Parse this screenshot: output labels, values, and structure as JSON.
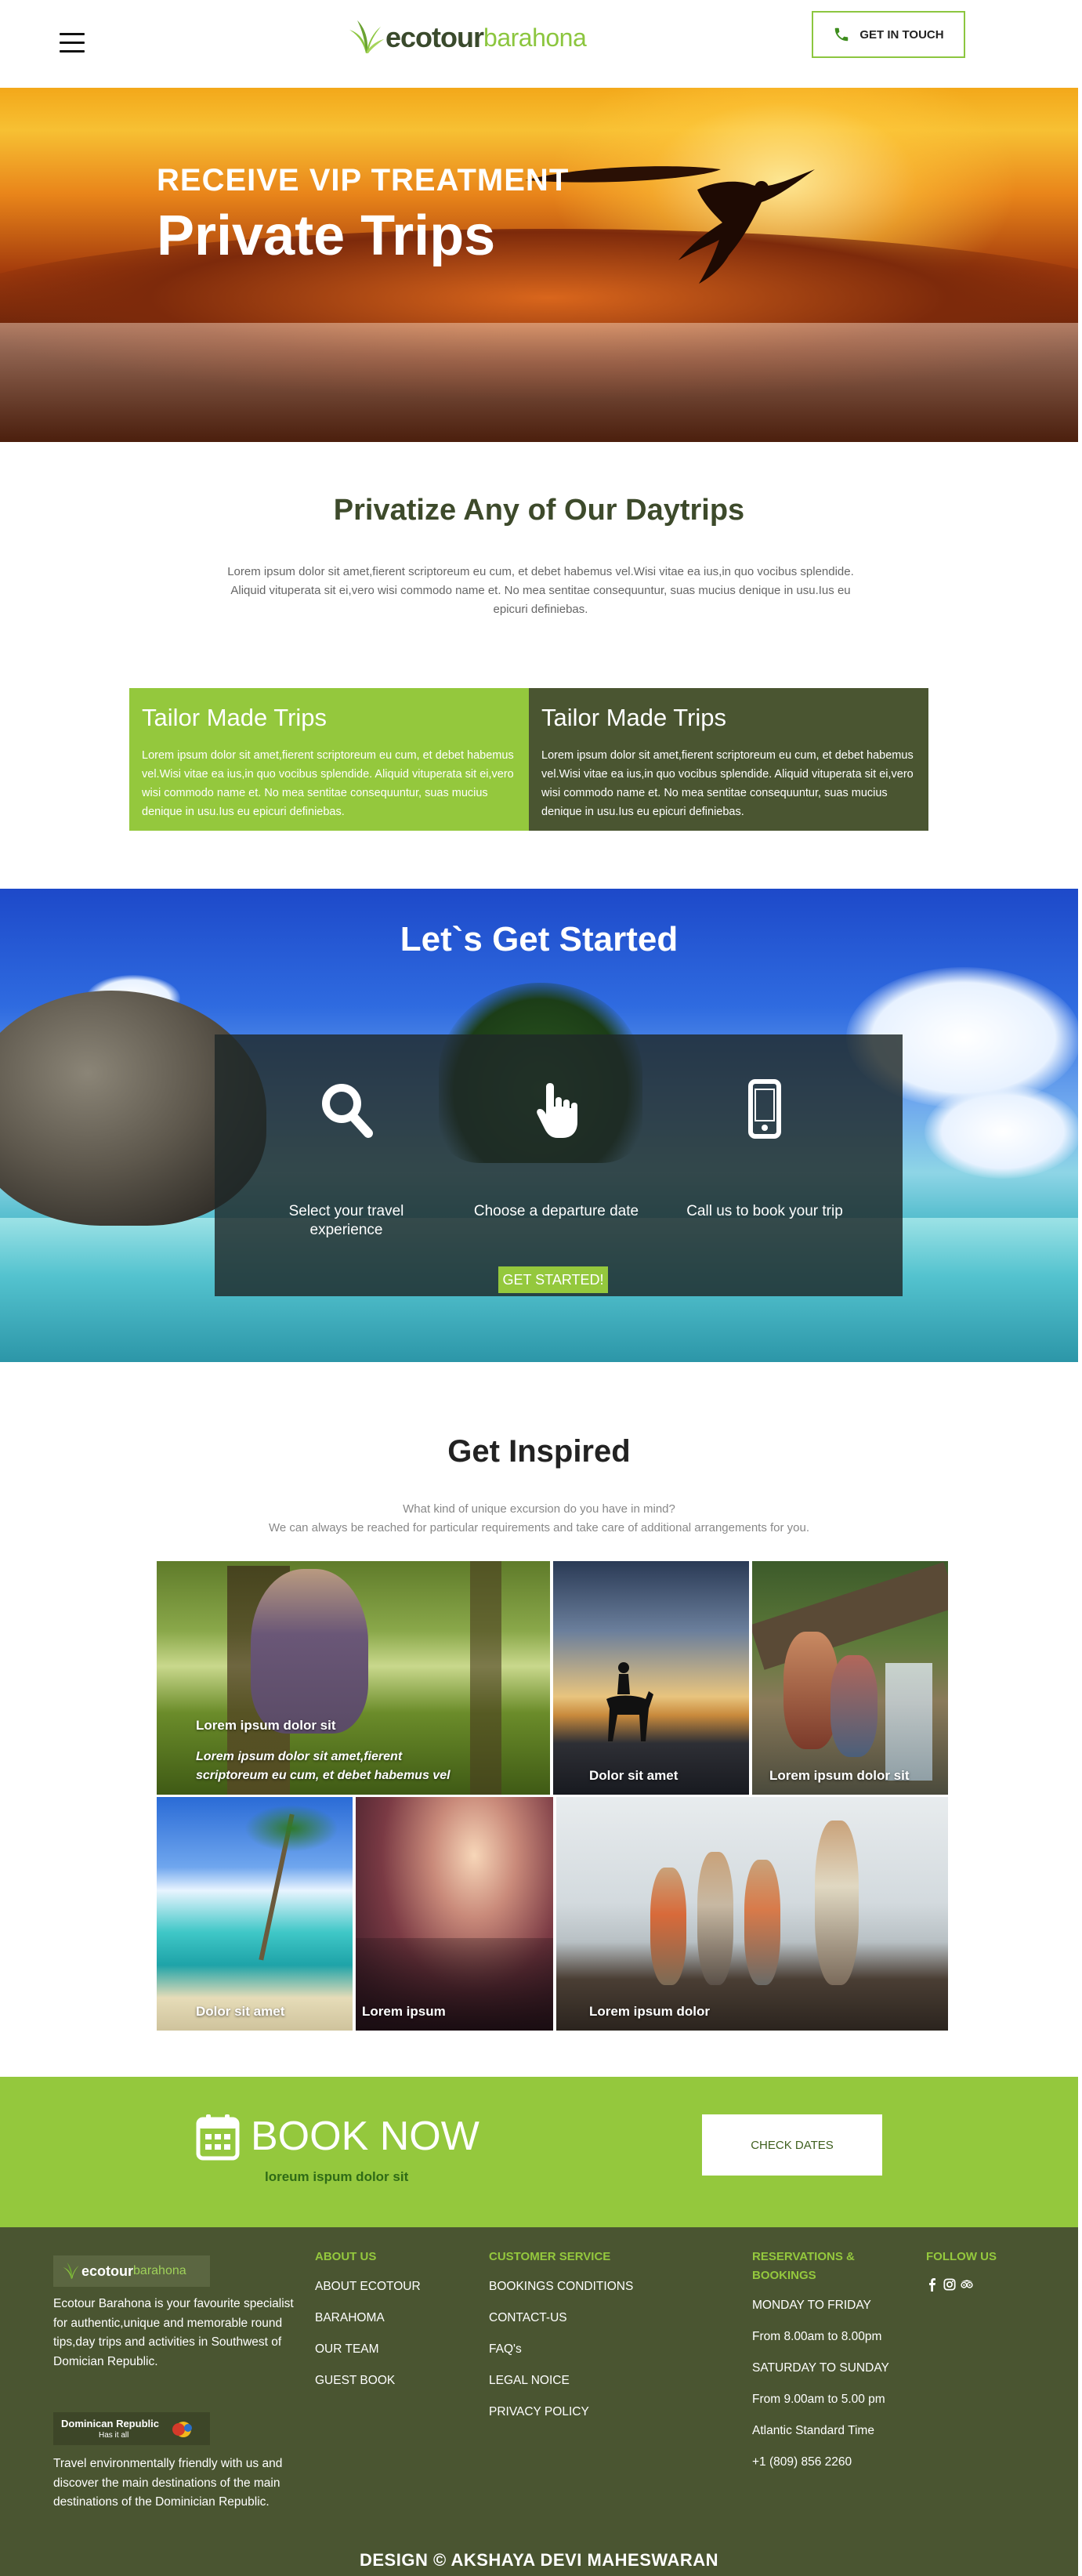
{
  "header": {
    "logo_eco": "ecotour",
    "logo_place": "barahona",
    "touch_label": "GET IN TOUCH"
  },
  "hero": {
    "kicker": "RECEIVE VIP TREATMENT",
    "title": "Private Trips"
  },
  "privatize": {
    "title": "Privatize Any of Our Daytrips",
    "text": "Lorem ipsum dolor sit amet,fierent scriptoreum eu cum, et debet habemus vel.Wisi vitae ea ius,in quo vocibus splendide. Aliquid vituperata sit ei,vero wisi commodo name et. No mea sentitae consequuntur, suas mucius denique in usu.Ius eu epicuri definiebas."
  },
  "tailor": [
    {
      "title": "Tailor Made Trips",
      "text": "Lorem ipsum dolor sit amet,fierent scriptoreum eu cum, et debet habemus vel.Wisi vitae ea ius,in quo vocibus splendide. Aliquid vituperata sit ei,vero wisi commodo name et. No mea sentitae consequuntur, suas mucius denique in usu.Ius eu epicuri definiebas."
    },
    {
      "title": "Tailor Made Trips",
      "text": "Lorem ipsum dolor sit amet,fierent scriptoreum eu cum, et debet habemus vel.Wisi vitae ea ius,in quo vocibus splendide. Aliquid vituperata sit ei,vero wisi commodo name et. No mea sentitae consequuntur, suas mucius denique in usu.Ius eu epicuri definiebas."
    }
  ],
  "started": {
    "title": "Let`s Get Started",
    "steps": [
      {
        "icon": "search-icon",
        "label": "Select your travel experience"
      },
      {
        "icon": "hand-pointer-icon",
        "label": "Choose a departure date"
      },
      {
        "icon": "mobile-phone-icon",
        "label": "Call us to book your trip"
      }
    ],
    "button": "GET STARTED!"
  },
  "inspired": {
    "title": "Get Inspired",
    "sub1": "What kind of unique excursion do you have in mind?",
    "sub2": "We can always be reached for particular requirements and take care of additional arrangements for you.",
    "tiles": [
      {
        "label": "Lorem ipsum dolor sit",
        "desc": "Lorem ipsum dolor sit amet,fierent scriptoreum eu cum, et debet habemus vel"
      },
      {
        "label": "Dolor sit amet"
      },
      {
        "label": "Lorem ipsum dolor sit"
      },
      {
        "label": "Dolor sit amet"
      },
      {
        "label": "Lorem ipsum"
      },
      {
        "label": "Lorem ipsum dolor"
      }
    ]
  },
  "book": {
    "icon": "calendar-icon",
    "title": "BOOK NOW",
    "sub": "loreum ispum dolor sit",
    "check": "CHECK DATES"
  },
  "footer": {
    "logo_eco": "ecotour",
    "logo_place": "barahona",
    "about": "Ecotour Barahona is your favourite specialist for authentic,unique and memorable round tips,day trips and activities in Southwest of Domician Republic.",
    "dr_title": "Dominican Republic",
    "dr_tag": "Has it all",
    "travel": "Travel environmentally friendly with us and discover the main destinations of the main destinations of the Dominician Republic.",
    "about_us": {
      "heading": "ABOUT US",
      "items": [
        "ABOUT ECOTOUR",
        "BARAHOMA",
        "OUR TEAM",
        "GUEST BOOK"
      ]
    },
    "service": {
      "heading": "CUSTOMER SERVICE",
      "items": [
        "BOOKINGS CONDITIONS",
        "CONTACT-US",
        "FAQ's",
        "LEGAL NOICE",
        "PRIVACY POLICY"
      ]
    },
    "reservations": {
      "heading": "RESERVATIONS & BOOKINGS",
      "items": [
        "MONDAY TO FRIDAY",
        "From 8.00am to 8.00pm",
        "SATURDAY TO SUNDAY",
        "From 9.00am to 5.00 pm",
        "Atlantic Standard Time",
        "+1 (809) 856 2260"
      ]
    },
    "follow": {
      "heading": "FOLLOW US",
      "icons": [
        "facebook-icon",
        "instagram-icon",
        "tripadvisor-icon"
      ]
    },
    "credit": "DESIGN © AKSHAYA DEVI MAHESWARAN"
  },
  "colors": {
    "brand_green": "#94c83d",
    "dark_olive": "#4a5531",
    "footer_link_green": "#94c83d"
  }
}
